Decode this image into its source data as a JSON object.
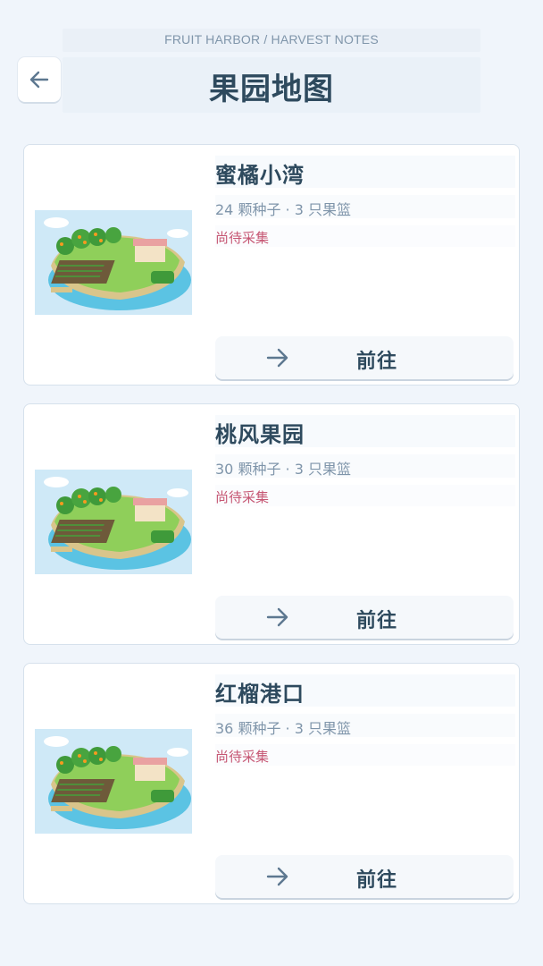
{
  "header": {
    "subtitle": "FRUIT HARBOR / HARVEST NOTES",
    "title": "果园地图",
    "back_icon": "arrow-left-icon"
  },
  "orchards": [
    {
      "name": "蜜橘小湾",
      "meta": "24 颗种子 · 3 只果篮",
      "status": "尚待采集",
      "action_label": "前往",
      "action_icon": "arrow-right-icon",
      "image": "island-orchard-illustration"
    },
    {
      "name": "桃风果园",
      "meta": "30 颗种子 · 3 只果篮",
      "status": "尚待采集",
      "action_label": "前往",
      "action_icon": "arrow-right-icon",
      "image": "island-orchard-illustration"
    },
    {
      "name": "红榴港口",
      "meta": "36 颗种子 · 3 只果篮",
      "status": "尚待采集",
      "action_label": "前往",
      "action_icon": "arrow-right-icon",
      "image": "island-orchard-illustration"
    }
  ],
  "colors": {
    "background": "#f0f5fb",
    "text_primary": "#2e4a5e",
    "text_secondary": "#7f95aa",
    "status": "#c65673"
  }
}
